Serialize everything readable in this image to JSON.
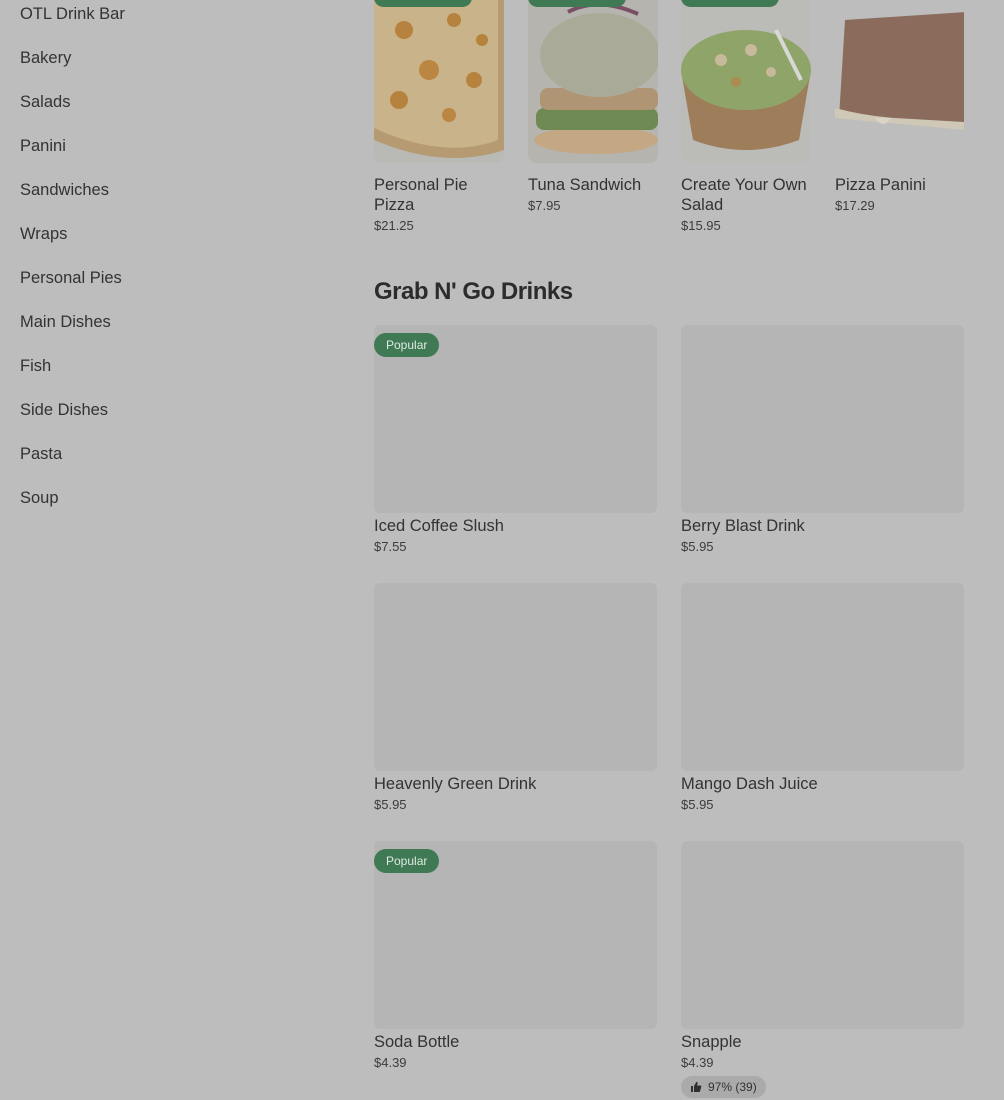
{
  "sidebar": {
    "items": [
      "OTL Drink Bar",
      "Bakery",
      "Salads",
      "Panini",
      "Sandwiches",
      "Wraps",
      "Personal Pies",
      "Main Dishes",
      "Fish",
      "Side Dishes",
      "Pasta",
      "Soup"
    ]
  },
  "featured": [
    {
      "name": "Personal Pie Pizza",
      "price": "$21.25"
    },
    {
      "name": "Tuna Sandwich",
      "price": "$7.95"
    },
    {
      "name": "Create Your Own Salad",
      "price": "$15.95"
    },
    {
      "name": "Pizza Panini",
      "price": "$17.29"
    }
  ],
  "section": {
    "title": "Grab N' Go Drinks",
    "items": [
      {
        "name": "Iced Coffee Slush",
        "price": "$7.55",
        "badge": "Popular"
      },
      {
        "name": "Berry Blast Drink",
        "price": "$5.95"
      },
      {
        "name": "Heavenly Green Drink",
        "price": "$5.95"
      },
      {
        "name": "Mango Dash Juice",
        "price": "$5.95"
      },
      {
        "name": "Soda Bottle",
        "price": "$4.39",
        "badge": "Popular"
      },
      {
        "name": "Snapple",
        "price": "$4.39",
        "rating": "97% (39)"
      }
    ]
  },
  "colors": {
    "background": "#bdbdbd",
    "accent": "#3f7a55",
    "placeholder": "#b5b5b5"
  }
}
